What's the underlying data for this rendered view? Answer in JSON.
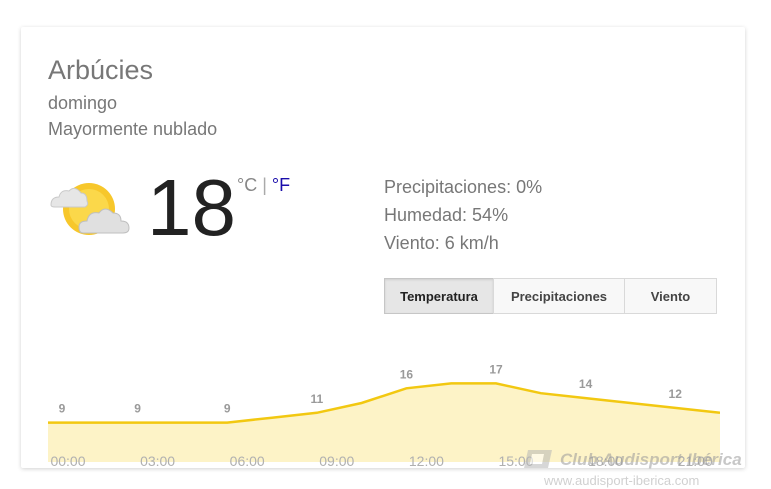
{
  "location": "Arbúcies",
  "day": "domingo",
  "condition": "Mayormente nublado",
  "current": {
    "temperature": "18",
    "unit_c": "°C",
    "separator": "|",
    "unit_f": "°F",
    "icon": "partly-cloudy-icon"
  },
  "details": {
    "precipitation": "Precipitaciones: 0%",
    "humidity": "Humedad: 54%",
    "wind": "Viento: 6 km/h"
  },
  "tabs": [
    {
      "label": "Temperatura",
      "active": true
    },
    {
      "label": "Precipitaciones",
      "active": false
    },
    {
      "label": "Viento",
      "active": false
    }
  ],
  "colors": {
    "line": "#f2c811",
    "fill": "#fdf3c7",
    "link": "#1a0dab"
  },
  "chart_data": {
    "type": "area",
    "x": [
      "00:00",
      "01:30",
      "03:00",
      "04:30",
      "06:00",
      "07:30",
      "09:00",
      "10:30",
      "12:00",
      "13:30",
      "15:00",
      "16:30",
      "18:00",
      "19:30",
      "21:00",
      "22:30"
    ],
    "values": [
      9,
      9,
      9,
      9,
      9,
      10,
      11,
      13,
      16,
      17,
      17,
      15,
      14,
      13,
      12,
      11
    ],
    "tick_labels": [
      "00:00",
      "03:00",
      "06:00",
      "09:00",
      "12:00",
      "15:00",
      "18:00",
      "21:00"
    ],
    "value_labels": [
      "9",
      "9",
      "9",
      "11",
      "16",
      "17",
      "14",
      "12"
    ],
    "ylim": [
      4,
      22
    ],
    "grid": false
  },
  "watermark": {
    "title": "Club Audisport Ibérica",
    "url": "www.audisport-iberica.com"
  }
}
